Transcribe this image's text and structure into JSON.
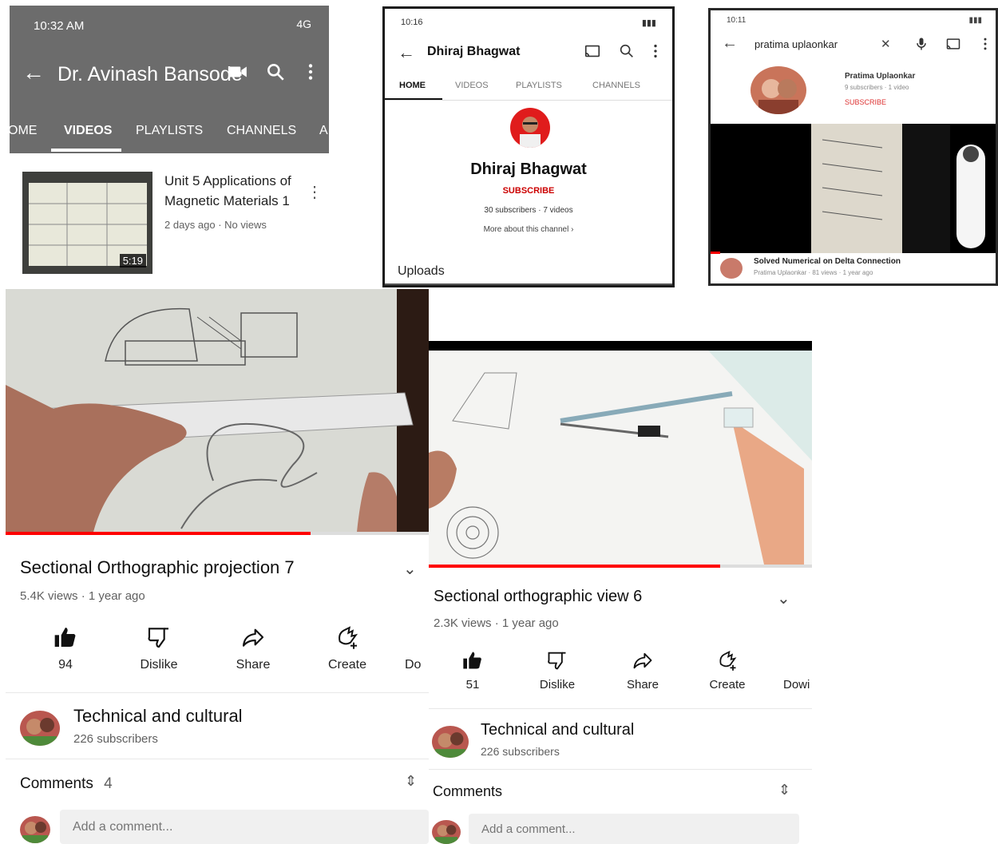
{
  "panel1": {
    "status": {
      "time": "10:32 AM",
      "network": "4G"
    },
    "title": "Dr. Avinash Bansode",
    "tabs": [
      "OME",
      "VIDEOS",
      "PLAYLISTS",
      "CHANNELS",
      "A"
    ],
    "video": {
      "title": "Unit 5 Applications of Magnetic Materials 1",
      "meta": "2 days ago · No views",
      "duration": "5:19"
    }
  },
  "panel2": {
    "status": {
      "time": "10:16"
    },
    "title": "Dhiraj Bhagwat",
    "tabs": [
      "HOME",
      "VIDEOS",
      "PLAYLISTS",
      "CHANNELS"
    ],
    "channel_name": "Dhiraj Bhagwat",
    "subscribe": "SUBSCRIBE",
    "stats": "30 subscribers · 7 videos",
    "more": "More about this channel",
    "uploads": "Uploads"
  },
  "panel3": {
    "status": {
      "time": "10:11"
    },
    "search_query": "pratima uplaonkar",
    "channel_name": "Pratima Uplaonkar",
    "channel_meta": "9 subscribers · 1 video",
    "subscribe": "SUBSCRIBE",
    "video_title": "Solved Numerical on Delta Connection",
    "video_meta": "Pratima Uplaonkar · 81 views · 1 year ago"
  },
  "panel4": {
    "title": "Sectional Orthographic projection 7",
    "meta": "5.4K views · 1 year ago",
    "progress": 0.72,
    "actions": {
      "like": "94",
      "dislike": "Dislike",
      "share": "Share",
      "create": "Create",
      "download": "Do"
    },
    "channel": {
      "name": "Technical and cultural",
      "subscribers": "226 subscribers"
    },
    "comments": {
      "label": "Comments",
      "count": "4",
      "placeholder": "Add a comment..."
    }
  },
  "panel5": {
    "title": "Sectional orthographic view 6",
    "meta": "2.3K views · 1 year ago",
    "progress": 0.76,
    "actions": {
      "like": "51",
      "dislike": "Dislike",
      "share": "Share",
      "create": "Create",
      "download": "Dowi"
    },
    "channel": {
      "name": "Technical and cultural",
      "subscribers": "226 subscribers"
    },
    "comments": {
      "label": "Comments",
      "placeholder": "Add a comment..."
    }
  },
  "icons": {
    "back": "arrow-left-icon",
    "video-camera": "video-camera-icon",
    "search": "search-icon",
    "more": "more-vert-icon",
    "cast": "cast-icon",
    "mic": "mic-icon",
    "like": "thumbs-up-icon",
    "dislike": "thumbs-down-icon",
    "share": "share-icon",
    "create": "create-icon",
    "expand": "chevron-down-icon",
    "sort": "sort-icon"
  },
  "colors": {
    "accent": "#ff0000",
    "subscribe": "#cc0000",
    "appbar": "#6c6c6c"
  }
}
